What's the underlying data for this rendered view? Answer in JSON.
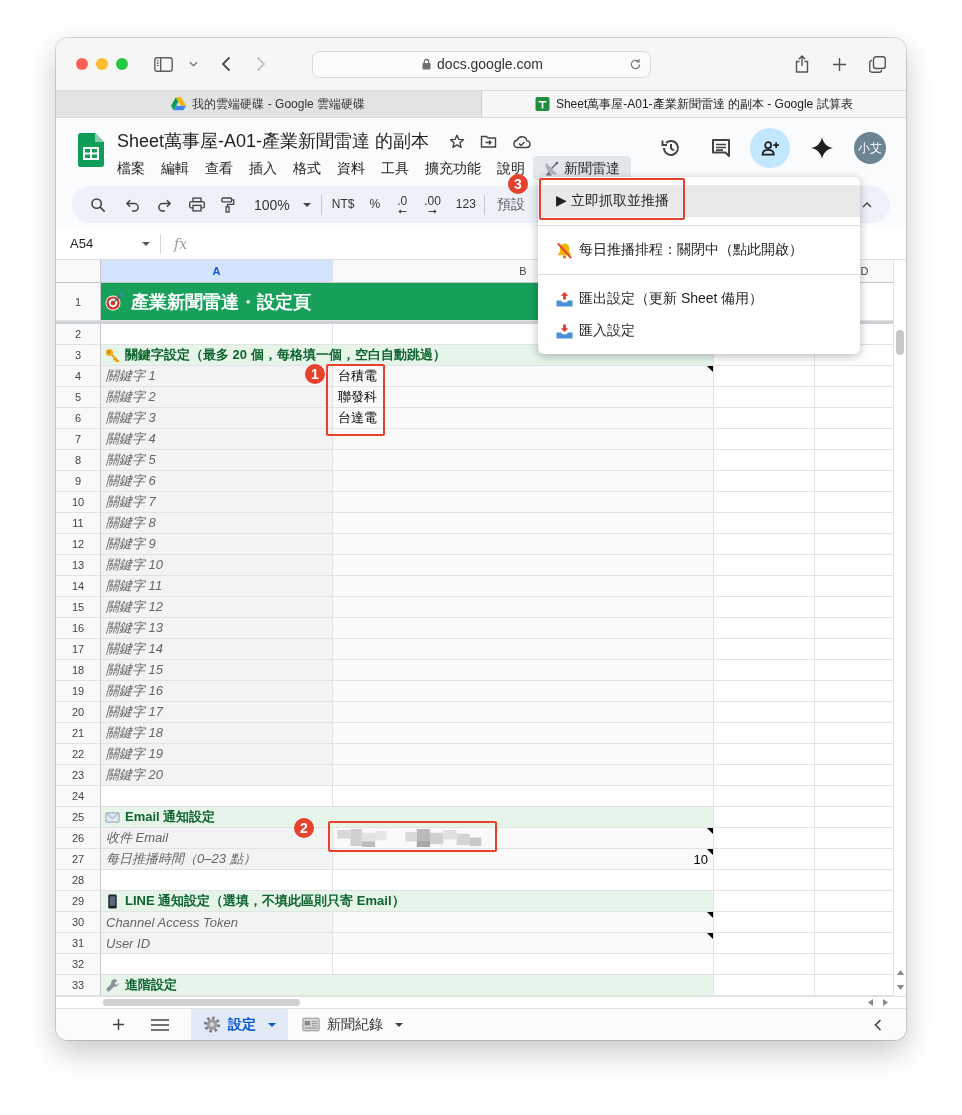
{
  "browser": {
    "url": "docs.google.com",
    "back_disabled": false,
    "forward_disabled": true,
    "tabs": [
      {
        "title": "我的雲端硬碟 - Google 雲端硬碟",
        "selected": false
      },
      {
        "title": "Sheet萬事屋-A01-產業新聞雷達 的副本 - Google 試算表",
        "selected": true
      }
    ]
  },
  "header": {
    "title": "Sheet萬事屋-A01-產業新聞雷達 的副本",
    "menus": [
      {
        "label": "檔案",
        "selected": false
      },
      {
        "label": "編輯",
        "selected": false
      },
      {
        "label": "查看",
        "selected": false
      },
      {
        "label": "插入",
        "selected": false
      },
      {
        "label": "格式",
        "selected": false
      },
      {
        "label": "資料",
        "selected": false
      },
      {
        "label": "工具",
        "selected": false
      },
      {
        "label": "擴充功能",
        "selected": false
      },
      {
        "label": "說明",
        "selected": false
      },
      {
        "label": "新聞雷達",
        "selected": true
      }
    ],
    "avatar": "小艾"
  },
  "toolbar": {
    "zoom": "100%",
    "formats": [
      {
        "label": "NT$",
        "kind": "text"
      },
      {
        "label": "%",
        "kind": "text"
      },
      {
        "label": ".0",
        "kind": "decrease"
      },
      {
        "label": ".00",
        "kind": "increase"
      },
      {
        "label": "123",
        "kind": "text"
      }
    ],
    "style": "預設"
  },
  "formula_bar": {
    "cell": "A54",
    "fx": "fx"
  },
  "sheet": {
    "columns": [
      {
        "label": "A",
        "selected": true
      },
      {
        "label": "B",
        "selected": false
      },
      {
        "label": "D",
        "selected": false
      }
    ],
    "rows": [
      {
        "n": "1",
        "kind": "title",
        "text": "產業新聞雷達・設定頁"
      },
      {
        "n": "2",
        "kind": "blank"
      },
      {
        "n": "3",
        "kind": "section",
        "text": "關鍵字設定（最多 20 個，每格填一個，空白自動跳過）"
      },
      {
        "n": "4",
        "kind": "field",
        "label": "關鍵字 1",
        "value": "台積電",
        "note": true
      },
      {
        "n": "5",
        "kind": "field",
        "label": "關鍵字 2",
        "value": "聯發科",
        "note": false
      },
      {
        "n": "6",
        "kind": "field",
        "label": "關鍵字 3",
        "value": "台達電",
        "note": false
      },
      {
        "n": "7",
        "kind": "field",
        "label": "關鍵字 4",
        "note": false
      },
      {
        "n": "8",
        "kind": "field",
        "label": "關鍵字 5",
        "note": false
      },
      {
        "n": "9",
        "kind": "field",
        "label": "關鍵字 6",
        "note": false
      },
      {
        "n": "10",
        "kind": "field",
        "label": "關鍵字 7",
        "note": false
      },
      {
        "n": "11",
        "kind": "field",
        "label": "關鍵字 8",
        "note": false
      },
      {
        "n": "12",
        "kind": "field",
        "label": "關鍵字 9",
        "note": false
      },
      {
        "n": "13",
        "kind": "field",
        "label": "關鍵字 10",
        "note": false
      },
      {
        "n": "14",
        "kind": "field",
        "label": "關鍵字 11",
        "note": false
      },
      {
        "n": "15",
        "kind": "field",
        "label": "關鍵字 12",
        "note": false
      },
      {
        "n": "16",
        "kind": "field",
        "label": "關鍵字 13",
        "note": false
      },
      {
        "n": "17",
        "kind": "field",
        "label": "關鍵字 14",
        "note": false
      },
      {
        "n": "18",
        "kind": "field",
        "label": "關鍵字 15",
        "note": false
      },
      {
        "n": "19",
        "kind": "field",
        "label": "關鍵字 16",
        "note": false
      },
      {
        "n": "20",
        "kind": "field",
        "label": "關鍵字 17",
        "note": false
      },
      {
        "n": "21",
        "kind": "field",
        "label": "關鍵字 18",
        "note": false
      },
      {
        "n": "22",
        "kind": "field",
        "label": "關鍵字 19",
        "note": false
      },
      {
        "n": "23",
        "kind": "field",
        "label": "關鍵字 20",
        "note": false
      },
      {
        "n": "24",
        "kind": "blank"
      },
      {
        "n": "25",
        "kind": "section",
        "text": "Email 通知設定"
      },
      {
        "n": "26",
        "kind": "redacted_field",
        "label": "收件 Email",
        "note": true
      },
      {
        "n": "27",
        "kind": "number_field",
        "label": "每日推播時間（0–23 點）",
        "value": "10",
        "note": true
      },
      {
        "n": "28",
        "kind": "blank"
      },
      {
        "n": "29",
        "kind": "section",
        "text": "LINE 通知設定（選填，不填此區則只寄 Email）"
      },
      {
        "n": "30",
        "kind": "field",
        "label": "Channel Access Token",
        "note": true
      },
      {
        "n": "31",
        "kind": "field",
        "label": "User ID",
        "note": true
      },
      {
        "n": "32",
        "kind": "blank"
      },
      {
        "n": "33",
        "kind": "section",
        "text": "進階設定"
      }
    ]
  },
  "sheet_tabs": [
    {
      "label": "設定",
      "selected": true
    },
    {
      "label": "新聞紀錄",
      "selected": false
    }
  ],
  "dropdown": {
    "items": [
      {
        "kind": "item",
        "label": "▶ 立即抓取並推播",
        "selected": true
      },
      {
        "kind": "divider"
      },
      {
        "kind": "item",
        "label": "每日推播排程：關閉中（點此開啟）",
        "selected": false
      },
      {
        "kind": "divider"
      },
      {
        "kind": "item",
        "label": "匯出設定（更新 Sheet 備用）",
        "selected": false
      },
      {
        "kind": "item",
        "label": "匯入設定",
        "selected": false
      }
    ]
  },
  "annotations": [
    {
      "number": "1"
    },
    {
      "number": "2"
    },
    {
      "number": "3"
    }
  ]
}
